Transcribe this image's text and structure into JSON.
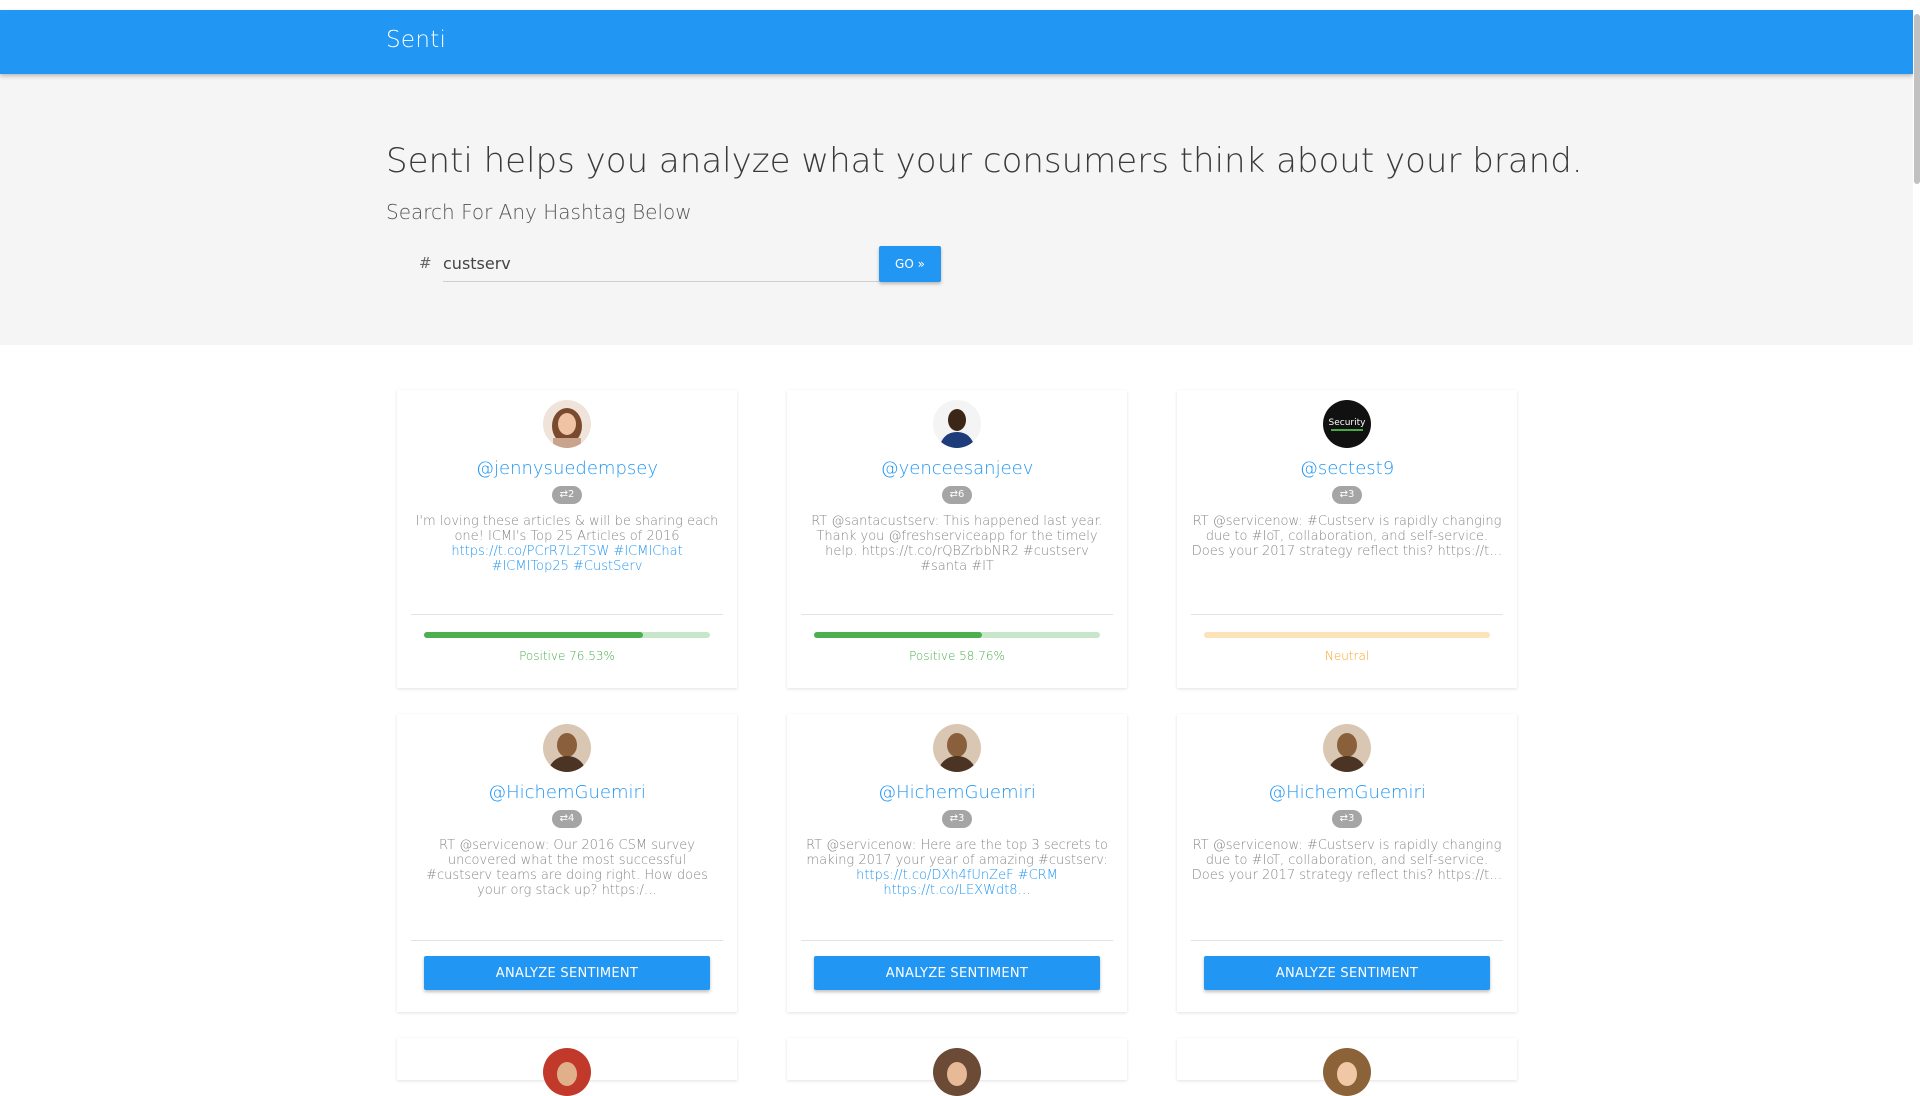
{
  "app": {
    "brand": "Senti"
  },
  "hero": {
    "headline": "Senti helps you analyze what your consumers think about your brand.",
    "subhead": "Search For Any Hashtag Below",
    "hash_symbol": "#",
    "search_value": "custserv",
    "go_label": "GO »"
  },
  "colors": {
    "primary": "#2196f3",
    "positive": "#4caf50",
    "positive_track": "#c8e6c9",
    "neutral": "#f5a623",
    "neutral_track": "#fde3b8"
  },
  "cards": [
    {
      "handle": "@jennysuedempsey",
      "retweets": "2",
      "tweet_lines": [
        "I'm loving these articles & will be sharing each",
        "one! ICMI's Top 25 Articles of 2016",
        "https://t.co/PCrR7LzTSW #ICMIChat",
        "#ICMITop25 #CustServ"
      ],
      "sentiment": "Positive 76.53%",
      "score": 0.7653,
      "kind": "positive"
    },
    {
      "handle": "@yenceesanjeev",
      "retweets": "6",
      "tweet_lines": [
        "RT @santacustserv: This happened last year.",
        "Thank you @freshserviceapp for the timely",
        "help. https://t.co/rQBZrbbNR2 #custserv",
        "#santa #IT"
      ],
      "sentiment": "Positive 58.76%",
      "score": 0.5876,
      "kind": "positive"
    },
    {
      "handle": "@sectest9",
      "retweets": "3",
      "tweet_lines": [
        "RT @servicenow: #Custserv is rapidly changing",
        "due to #IoT, collaboration, and self-service.",
        "Does your 2017 strategy reflect this? https://t…"
      ],
      "sentiment": "Neutral",
      "score": 1.0,
      "kind": "neutral"
    },
    {
      "handle": "@HichemGuemiri",
      "retweets": "4",
      "tweet_lines": [
        "RT @servicenow: Our 2016 CSM survey",
        "uncovered what the most successful",
        "#custserv teams are doing right. How does",
        "your org stack up? https:/…"
      ],
      "button": "ANALYZE SENTIMENT"
    },
    {
      "handle": "@HichemGuemiri",
      "retweets": "3",
      "tweet_lines": [
        "RT @servicenow: Here are the top 3 secrets to",
        "making 2017 your year of amazing #custserv:",
        "https://t.co/DXh4fUnZeF #CRM",
        "https://t.co/LEXWdt8…"
      ],
      "button": "ANALYZE SENTIMENT"
    },
    {
      "handle": "@HichemGuemiri",
      "retweets": "3",
      "tweet_lines": [
        "RT @servicenow: #Custserv is rapidly changing",
        "due to #IoT, collaboration, and self-service.",
        "Does your 2017 strategy reflect this? https://t…"
      ],
      "button": "ANALYZE SENTIMENT"
    }
  ]
}
